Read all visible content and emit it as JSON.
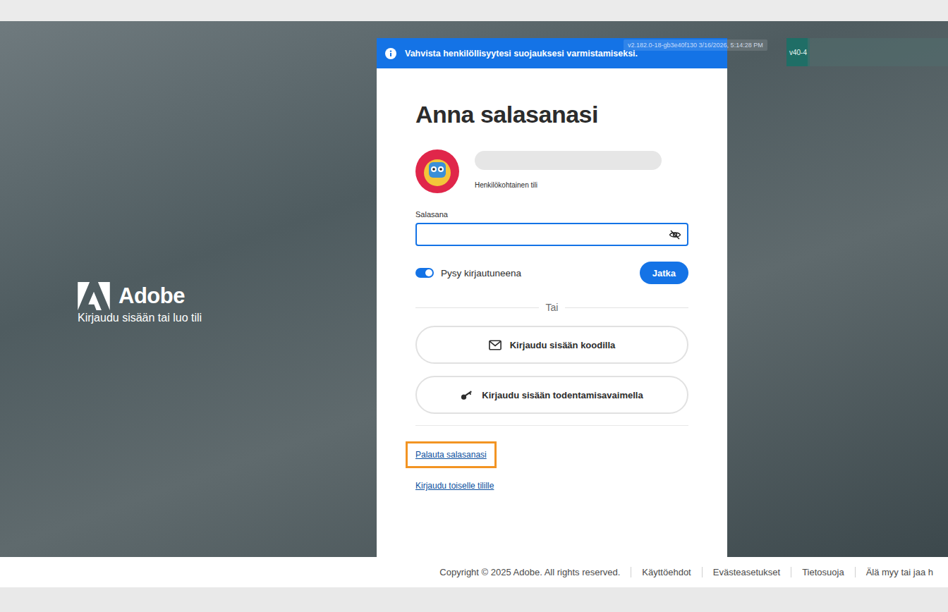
{
  "brand": {
    "name": "Adobe",
    "tagline": "Kirjaudu sisään tai luo tili"
  },
  "banner": {
    "text": "Vahvista henkilöllisyytesi suojauksesi varmistamiseksi."
  },
  "debug": {
    "build": "v2.182.0-18-gb3e40f130 3/16/2026, 5:14:28 PM",
    "tag": "v40-4"
  },
  "card": {
    "title": "Anna salasanasi",
    "account": {
      "type": "Henkilökohtainen tili"
    },
    "password": {
      "label": "Salasana",
      "value": "",
      "focused": true
    },
    "stay_signed_in": {
      "label": "Pysy kirjautuneena",
      "on": true
    },
    "continue_button": "Jatka",
    "divider": "Tai",
    "alt_buttons": [
      {
        "label": "Kirjaudu sisään koodilla",
        "kind": "code"
      },
      {
        "label": "Kirjaudu sisään todentamisavaimella",
        "kind": "passkey"
      }
    ],
    "links": [
      {
        "label": "Palauta salasanasi",
        "highlighted": true
      },
      {
        "label": "Kirjaudu toiselle tilille",
        "highlighted": false
      }
    ]
  },
  "footer": {
    "copyright": "Copyright © 2025 Adobe. All rights reserved.",
    "links": [
      "Käyttöehdot",
      "Evästeasetukset",
      "Tietosuoja",
      "Älä myy tai jaa h"
    ]
  }
}
